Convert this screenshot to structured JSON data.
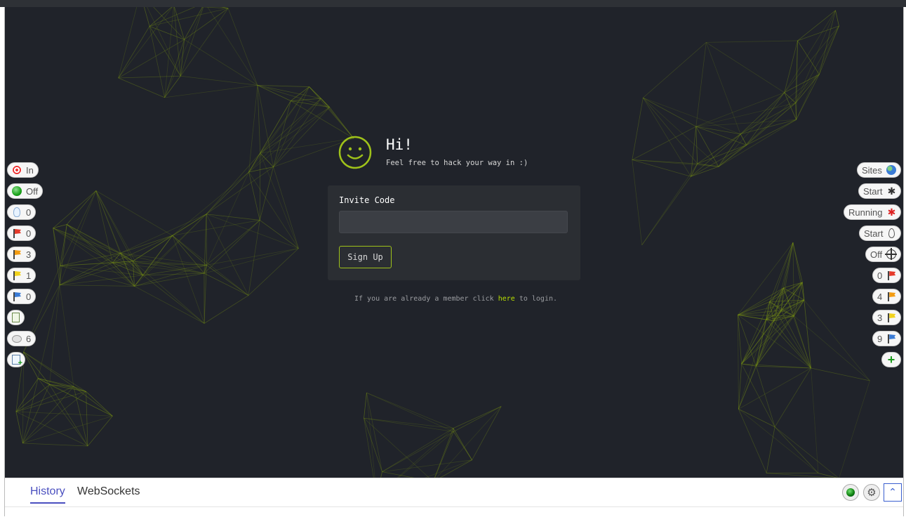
{
  "greeting": {
    "title": "Hi!",
    "subtitle": "Feel free to hack your way in :)"
  },
  "form": {
    "invite_label": "Invite Code",
    "invite_value": "",
    "signup_label": "Sign Up"
  },
  "member_note": {
    "before": "If you are already a member click ",
    "link": "here",
    "after": " to login."
  },
  "hud_left": [
    {
      "icon": "target-icon",
      "label": "In"
    },
    {
      "icon": "green-dot-icon",
      "label": "Off"
    },
    {
      "icon": "lightbulb-icon",
      "label": "0"
    },
    {
      "icon": "red-flag-icon",
      "label": "0",
      "color": "#e53a2a"
    },
    {
      "icon": "orange-flag-icon",
      "label": "3",
      "color": "#f39c12"
    },
    {
      "icon": "yellow-flag-icon",
      "label": "1",
      "color": "#f1d21b"
    },
    {
      "icon": "blue-flag-icon",
      "label": "0",
      "color": "#3a7bd5"
    },
    {
      "icon": "notes-icon",
      "label": ""
    },
    {
      "icon": "speech-bubble-icon",
      "label": "6"
    },
    {
      "icon": "add-page-icon",
      "label": ""
    }
  ],
  "hud_right": [
    {
      "icon": "globe-icon",
      "label": "Sites"
    },
    {
      "icon": "spider-icon",
      "label": "Start"
    },
    {
      "icon": "red-spider-icon",
      "label": "Running"
    },
    {
      "icon": "flame-icon",
      "label": "Start"
    },
    {
      "icon": "crosshair-icon",
      "label": "Off"
    },
    {
      "icon": "red-flag-icon",
      "label": "0",
      "color": "#e53a2a"
    },
    {
      "icon": "orange-flag-icon",
      "label": "4",
      "color": "#f39c12"
    },
    {
      "icon": "yellow-flag-icon",
      "label": "3",
      "color": "#f1d21b"
    },
    {
      "icon": "blue-flag-icon",
      "label": "9",
      "color": "#3a7bd5"
    },
    {
      "icon": "plus-icon",
      "label": ""
    }
  ],
  "bottom_tabs": [
    {
      "label": "History",
      "active": true
    },
    {
      "label": "WebSockets",
      "active": false
    }
  ],
  "colors": {
    "accent": "#9fc21a",
    "link": "#b8e000",
    "background": "#20232a",
    "tab_active": "#4a4fbf"
  }
}
